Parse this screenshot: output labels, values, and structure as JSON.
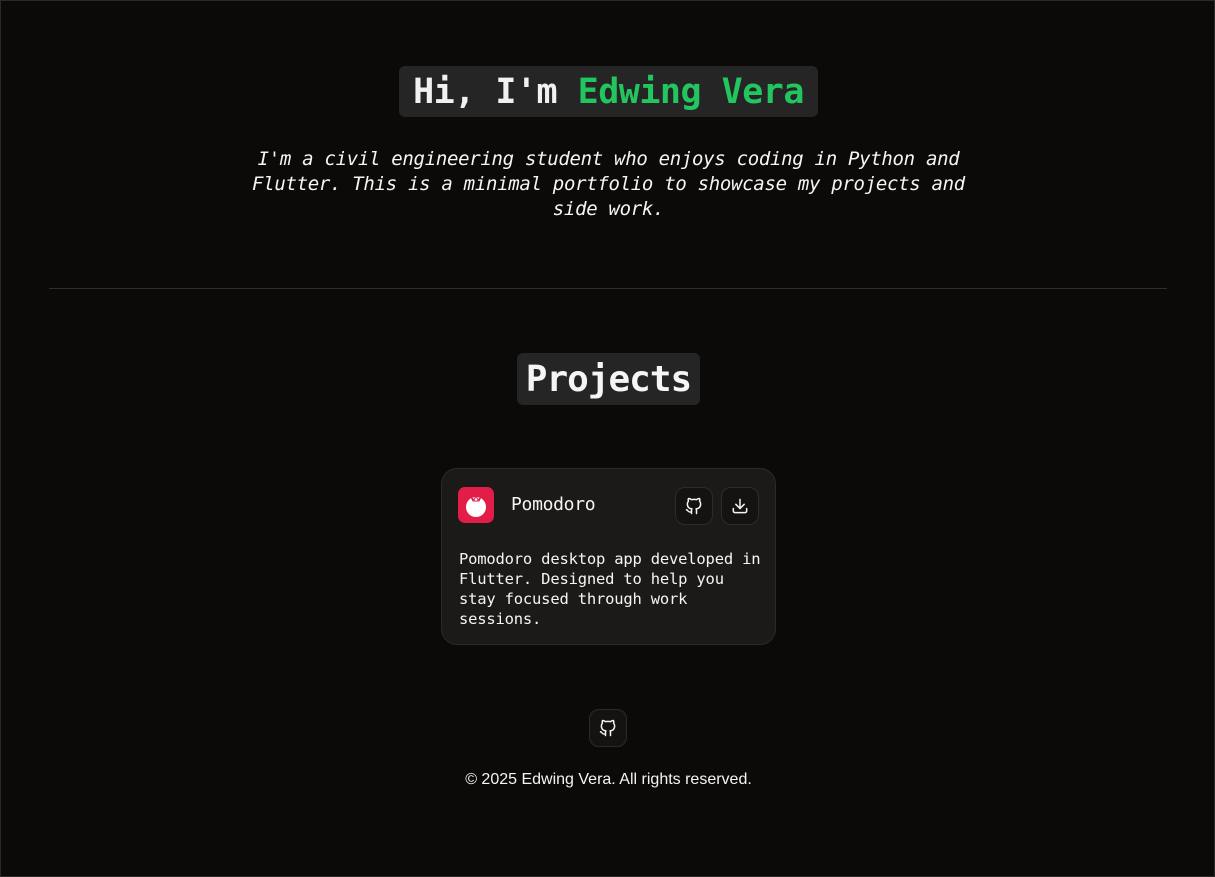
{
  "hero": {
    "greeting": "Hi, I'm ",
    "name": "Edwing Vera",
    "name_color": "#22c55e",
    "intro": "I'm a civil engineering student who enjoys coding in Python and Flutter. This is a minimal portfolio to showcase my projects and side work."
  },
  "projects": {
    "title": "Projects",
    "items": [
      {
        "name": "Pomodoro",
        "icon": "tomato-icon",
        "icon_color": "#e11d48",
        "description": "Pomodoro desktop app developed in Flutter. Designed to help you stay focused through work sessions.",
        "actions": [
          "github-icon",
          "download-icon"
        ]
      }
    ]
  },
  "footer": {
    "icon": "github-icon",
    "copyright": "© 2025 Edwing Vera. All rights reserved."
  },
  "colors": {
    "background": "#0b0a08",
    "card": "#1c1a18",
    "accent": "#22c55e"
  }
}
